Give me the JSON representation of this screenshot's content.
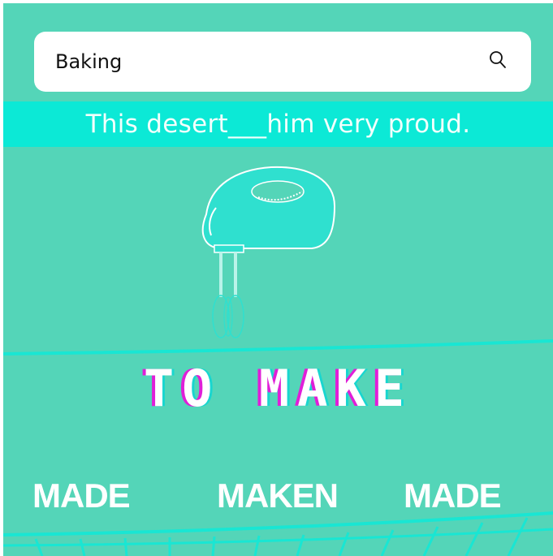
{
  "search": {
    "query": "Baking",
    "icon": "search-icon"
  },
  "question": {
    "sentence": "This desert___him very proud."
  },
  "illustration": {
    "icon": "hand-mixer-icon"
  },
  "prompt": {
    "title": "TO MAKE"
  },
  "options": [
    {
      "label": "MADE"
    },
    {
      "label": "MAKEN"
    },
    {
      "label": "MADE"
    }
  ],
  "colors": {
    "background": "#54d5b8",
    "band": "#0ce9d6",
    "accent_magenta": "#e01fd8",
    "accent_cyan": "#19d6cf",
    "mixer_fill": "#2fe0cf"
  }
}
